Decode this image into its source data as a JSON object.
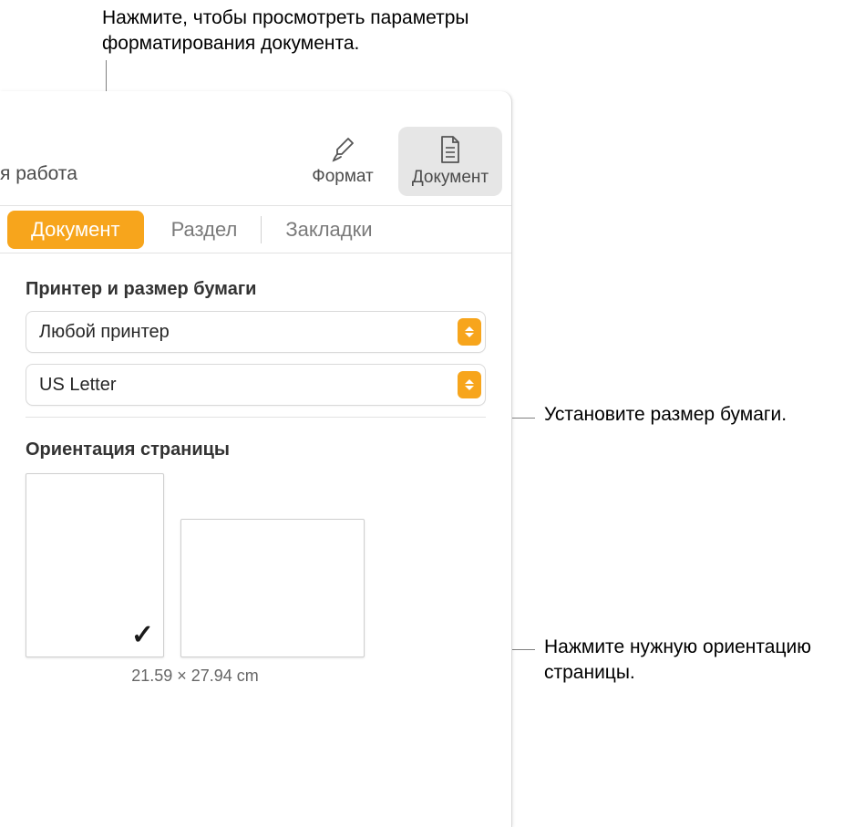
{
  "callouts": {
    "top": "Нажмите, чтобы просмотреть параметры форматирования документа.",
    "paper_size": "Установите размер бумаги.",
    "orientation": "Нажмите нужную ориентацию страницы."
  },
  "toolbar": {
    "left_partial": "я работа",
    "format_label": "Формат",
    "document_label": "Документ"
  },
  "tabs": {
    "document": "Документ",
    "section": "Раздел",
    "bookmarks": "Закладки"
  },
  "printer_section": {
    "heading": "Принтер и размер бумаги",
    "printer_value": "Любой принтер",
    "paper_value": "US Letter"
  },
  "orientation_section": {
    "heading": "Ориентация страницы",
    "dimensions": "21.59 × 27.94 cm",
    "checkmark": "✓"
  }
}
